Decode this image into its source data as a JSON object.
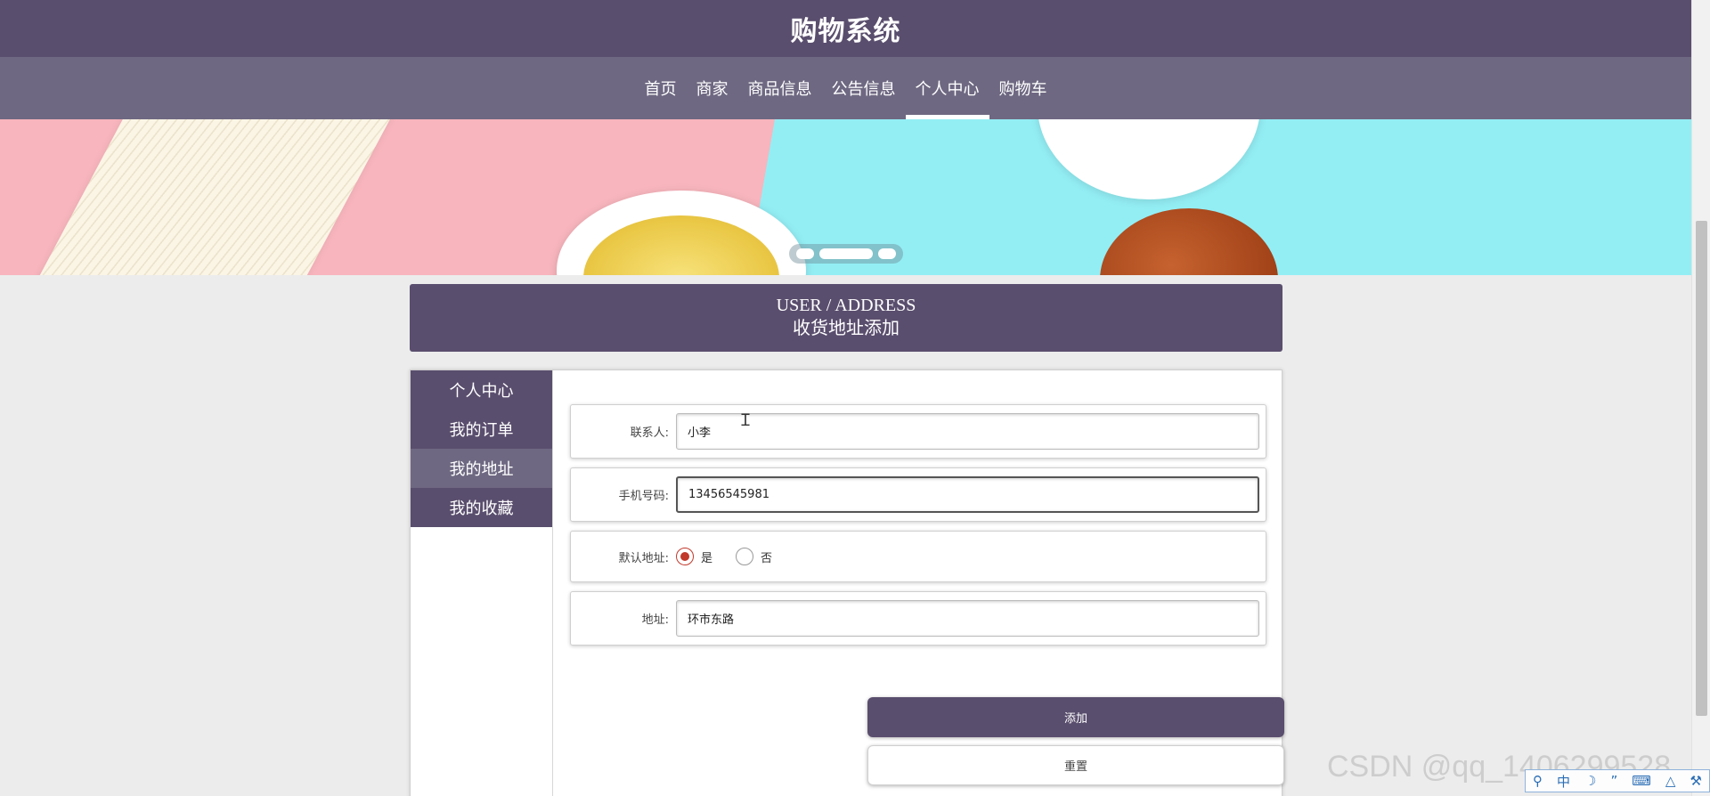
{
  "site": {
    "title": "购物系统"
  },
  "nav": {
    "items": [
      {
        "label": "首页"
      },
      {
        "label": "商家"
      },
      {
        "label": "商品信息"
      },
      {
        "label": "公告信息"
      },
      {
        "label": "个人中心"
      },
      {
        "label": "购物车"
      }
    ],
    "active_index": 4
  },
  "banner": {
    "dots": 3,
    "active_dot": 1
  },
  "page_header": {
    "title_en": "USER / ADDRESS",
    "title_cn": "收货地址添加"
  },
  "sidebar": {
    "items": [
      {
        "label": "个人中心"
      },
      {
        "label": "我的订单"
      },
      {
        "label": "我的地址"
      },
      {
        "label": "我的收藏"
      }
    ],
    "active_index": 2
  },
  "form": {
    "contact": {
      "label": "联系人:",
      "value": "小李"
    },
    "phone": {
      "label": "手机号码:",
      "value": "13456545981"
    },
    "default_address": {
      "label": "默认地址:",
      "options": [
        "是",
        "否"
      ],
      "selected": "是"
    },
    "address": {
      "label": "地址:",
      "value": "环市东路"
    },
    "submit_label": "添加",
    "reset_label": "重置"
  },
  "watermark": "CSDN @qq_1406299528",
  "ime": {
    "icons": [
      "search-icon",
      "zh-icon",
      "moon-icon",
      "punct-icon",
      "keyboard-icon",
      "shirt-icon",
      "wrench-icon"
    ],
    "zh_label": "中"
  },
  "colors": {
    "primary": "#5a4e6e",
    "nav_bg": "#6f6882",
    "page_bg": "#ececec",
    "radio_checked": "#c0392b"
  }
}
